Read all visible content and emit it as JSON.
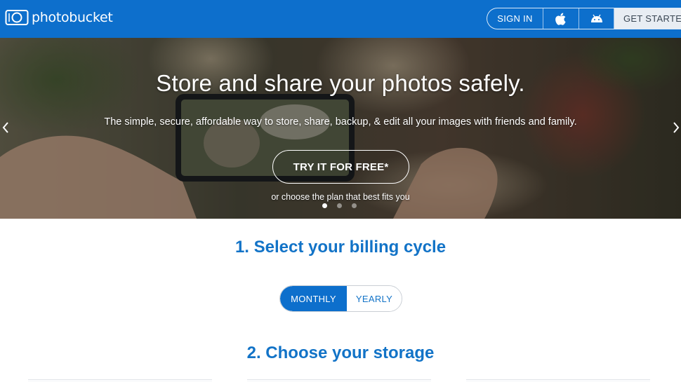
{
  "header": {
    "logo_text": "photobucket",
    "nav": {
      "sign_in": "SIGN IN",
      "ios_icon": "apple-icon",
      "android_icon": "android-icon",
      "get_started": "GET STARTED"
    }
  },
  "hero": {
    "title": "Store and share your photos safely.",
    "subtitle": "The simple, secure, affordable way to store, share, backup, & edit all your images with friends and family.",
    "cta": "TRY IT FOR FREE*",
    "plan_link": "or choose the plan that best fits you",
    "slides": 3,
    "active_slide": 1
  },
  "billing": {
    "title": "1. Select your billing cycle",
    "options": [
      "MONTHLY",
      "YEARLY"
    ],
    "selected": "MONTHLY"
  },
  "storage": {
    "title": "2. Choose your storage"
  },
  "colors": {
    "brand_blue": "#0d6fcc",
    "heading_blue": "#1273c7"
  }
}
